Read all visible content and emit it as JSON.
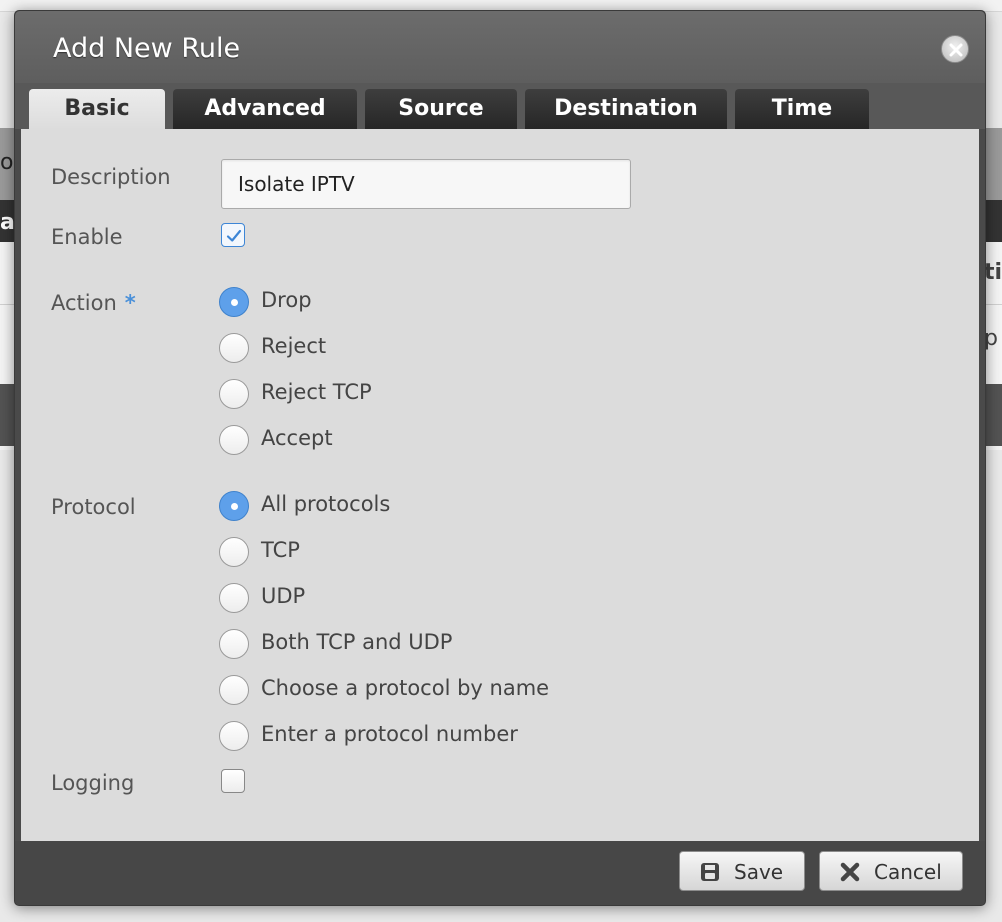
{
  "background": {
    "fragment_1": "on",
    "fragment_2": "ati",
    "fragment_3": "ti",
    "fragment_4": "p"
  },
  "dialog": {
    "title": "Add New Rule",
    "tabs": [
      {
        "label": "Basic",
        "active": true
      },
      {
        "label": "Advanced",
        "active": false
      },
      {
        "label": "Source",
        "active": false
      },
      {
        "label": "Destination",
        "active": false
      },
      {
        "label": "Time",
        "active": false
      }
    ],
    "form": {
      "description": {
        "label": "Description",
        "value": "Isolate IPTV"
      },
      "enable": {
        "label": "Enable",
        "checked": true
      },
      "action": {
        "label": "Action",
        "required_marker": "*",
        "options": [
          {
            "label": "Drop",
            "selected": true
          },
          {
            "label": "Reject",
            "selected": false
          },
          {
            "label": "Reject TCP",
            "selected": false
          },
          {
            "label": "Accept",
            "selected": false
          }
        ]
      },
      "protocol": {
        "label": "Protocol",
        "options": [
          {
            "label": "All protocols",
            "selected": true
          },
          {
            "label": "TCP",
            "selected": false
          },
          {
            "label": "UDP",
            "selected": false
          },
          {
            "label": "Both TCP and UDP",
            "selected": false
          },
          {
            "label": "Choose a protocol by name",
            "selected": false
          },
          {
            "label": "Enter a protocol number",
            "selected": false
          }
        ]
      },
      "logging": {
        "label": "Logging",
        "checked": false
      }
    },
    "buttons": {
      "save_label": "Save",
      "cancel_label": "Cancel"
    }
  },
  "colors": {
    "accent": "#5ea0ea",
    "title_bar": "#5e5e5e",
    "tab_inactive": "#262626",
    "body": "#dcdcdc"
  },
  "icons": {
    "close": "close-x-icon",
    "save": "floppy-disk-icon",
    "cancel": "x-mark-icon",
    "check": "checkmark-icon"
  }
}
